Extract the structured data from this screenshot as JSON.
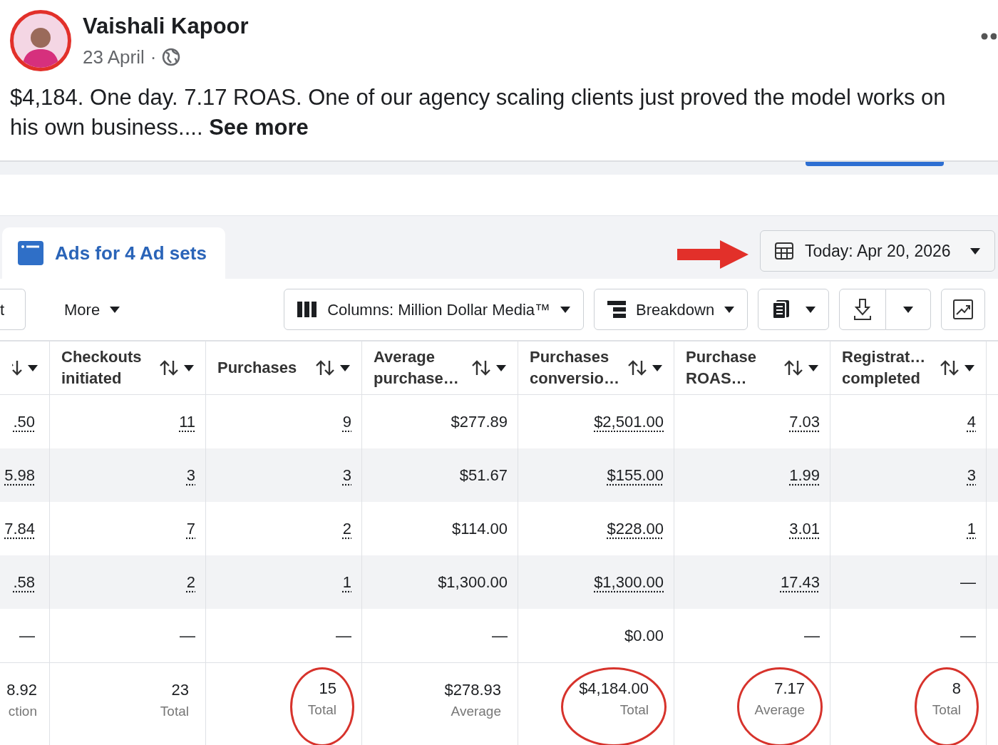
{
  "post": {
    "author": "Vaishali Kapoor",
    "date": "23 April",
    "separator": "·",
    "text": "$4,184. One day. 7.17 ROAS. One of our agency scaling clients just proved the model works on his own business....",
    "see_more": "See more"
  },
  "ads_manager": {
    "tab": {
      "label": "Ads for 4 Ad sets",
      "selected": true
    },
    "date_button": "Today: Apr 20, 2026",
    "toolbar": {
      "cut_button": "t",
      "more": "More",
      "columns": "Columns: Million Dollar Media™",
      "breakdown": "Breakdown"
    },
    "table": {
      "columns": [
        "Checkouts initiated",
        "Purchases",
        "Average purchase…",
        "Purchases conversio…",
        "Purchase ROAS…",
        "Registrat… completed"
      ],
      "rows": [
        {
          "cells": [
            {
              "text": ".50",
              "underlined": true
            },
            {
              "text": "11",
              "underlined": true
            },
            {
              "text": "9",
              "underlined": true
            },
            {
              "text": "$277.89",
              "underlined": false
            },
            {
              "text": "$2,501.00",
              "underlined": true
            },
            {
              "text": "7.03",
              "underlined": true
            },
            {
              "text": "4",
              "underlined": true
            }
          ]
        },
        {
          "cells": [
            {
              "text": "5.98",
              "underlined": true
            },
            {
              "text": "3",
              "underlined": true
            },
            {
              "text": "3",
              "underlined": true
            },
            {
              "text": "$51.67",
              "underlined": false
            },
            {
              "text": "$155.00",
              "underlined": true
            },
            {
              "text": "1.99",
              "underlined": true
            },
            {
              "text": "3",
              "underlined": true
            }
          ]
        },
        {
          "cells": [
            {
              "text": "7.84",
              "underlined": true
            },
            {
              "text": "7",
              "underlined": true
            },
            {
              "text": "2",
              "underlined": true
            },
            {
              "text": "$114.00",
              "underlined": false
            },
            {
              "text": "$228.00",
              "underlined": true
            },
            {
              "text": "3.01",
              "underlined": true
            },
            {
              "text": "1",
              "underlined": true
            }
          ]
        },
        {
          "cells": [
            {
              "text": ".58",
              "underlined": true
            },
            {
              "text": "2",
              "underlined": true
            },
            {
              "text": "1",
              "underlined": true
            },
            {
              "text": "$1,300.00",
              "underlined": false
            },
            {
              "text": "$1,300.00",
              "underlined": true
            },
            {
              "text": "17.43",
              "underlined": true
            },
            {
              "text": "—",
              "underlined": false
            }
          ]
        },
        {
          "cells": [
            {
              "text": "—",
              "underlined": false
            },
            {
              "text": "—",
              "underlined": false
            },
            {
              "text": "—",
              "underlined": false
            },
            {
              "text": "—",
              "underlined": false
            },
            {
              "text": "$0.00",
              "underlined": false
            },
            {
              "text": "—",
              "underlined": false
            },
            {
              "text": "—",
              "underlined": false
            }
          ]
        }
      ],
      "totals": [
        {
          "value": "8.92",
          "label": "ction",
          "circled": false
        },
        {
          "value": "23",
          "label": "Total",
          "circled": false
        },
        {
          "value": "15",
          "label": "Total",
          "circled": true
        },
        {
          "value": "$278.93",
          "label": "Average",
          "circled": false
        },
        {
          "value": "$4,184.00",
          "label": "Total",
          "circled": true
        },
        {
          "value": "7.17",
          "label": "Average",
          "circled": true
        },
        {
          "value": "8",
          "label": "Total",
          "circled": true
        }
      ]
    }
  }
}
